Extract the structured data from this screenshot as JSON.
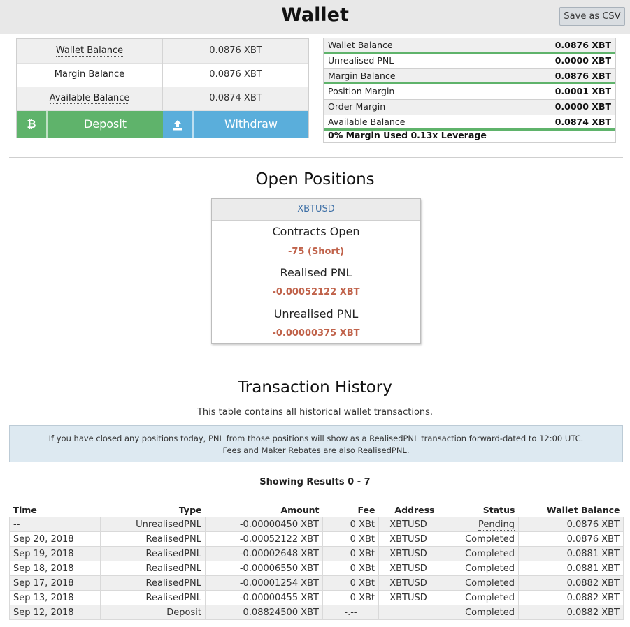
{
  "header": {
    "title": "Wallet",
    "csv_label": "Save as CSV"
  },
  "balances": [
    {
      "label": "Wallet Balance",
      "value": "0.0876 XBT"
    },
    {
      "label": "Margin Balance",
      "value": "0.0876 XBT"
    },
    {
      "label": "Available Balance",
      "value": "0.0874 XBT"
    }
  ],
  "buttons": {
    "deposit_label": "Deposit",
    "deposit_icon": "bitcoin-icon",
    "withdraw_label": "Withdraw",
    "withdraw_icon": "upload-icon"
  },
  "margin": {
    "rows": [
      {
        "label": "Wallet Balance",
        "value": "0.0876 XBT"
      },
      {
        "label": "Unrealised PNL",
        "value": "0.0000 XBT"
      },
      {
        "label": "Margin Balance",
        "value": "0.0876 XBT"
      },
      {
        "label": "Position Margin",
        "value": "0.0001 XBT"
      },
      {
        "label": "Order Margin",
        "value": "0.0000 XBT"
      },
      {
        "label": "Available Balance",
        "value": "0.0874 XBT"
      }
    ],
    "summary": "0% Margin Used 0.13x Leverage"
  },
  "positions": {
    "heading": "Open Positions",
    "symbol": "XBTUSD",
    "contracts_label": "Contracts Open",
    "contracts_value": "-75 (Short)",
    "realised_label": "Realised PNL",
    "realised_value": "-0.00052122 XBT",
    "unrealised_label": "Unrealised PNL",
    "unrealised_value": "-0.00000375 XBT"
  },
  "history": {
    "heading": "Transaction History",
    "subtitle": "This table contains all historical wallet transactions.",
    "notice_line1": "If you have closed any positions today, PNL from those positions will show as a RealisedPNL transaction forward-dated to 12:00 UTC.",
    "notice_line2": "Fees and Maker Rebates are also RealisedPNL.",
    "showing": "Showing Results 0 - 7",
    "columns": [
      "Time",
      "Type",
      "Amount",
      "Fee",
      "Address",
      "Status",
      "Wallet Balance"
    ],
    "rows": [
      [
        "--",
        "UnrealisedPNL",
        "-0.00000450 XBT",
        "0 XBt",
        "XBTUSD",
        "Pending",
        "0.0876 XBT"
      ],
      [
        "Sep 20, 2018",
        "RealisedPNL",
        "-0.00052122 XBT",
        "0 XBt",
        "XBTUSD",
        "Completed",
        "0.0876 XBT"
      ],
      [
        "Sep 19, 2018",
        "RealisedPNL",
        "-0.00002648 XBT",
        "0 XBt",
        "XBTUSD",
        "Completed",
        "0.0881 XBT"
      ],
      [
        "Sep 18, 2018",
        "RealisedPNL",
        "-0.00006550 XBT",
        "0 XBt",
        "XBTUSD",
        "Completed",
        "0.0881 XBT"
      ],
      [
        "Sep 17, 2018",
        "RealisedPNL",
        "-0.00001254 XBT",
        "0 XBt",
        "XBTUSD",
        "Completed",
        "0.0882 XBT"
      ],
      [
        "Sep 13, 2018",
        "RealisedPNL",
        "-0.00000455 XBT",
        "0 XBt",
        "XBTUSD",
        "Completed",
        "0.0882 XBT"
      ],
      [
        "Sep 12, 2018",
        "Deposit",
        "0.08824500 XBT",
        "-.--",
        "",
        "Completed",
        "0.0882 XBT"
      ]
    ]
  }
}
